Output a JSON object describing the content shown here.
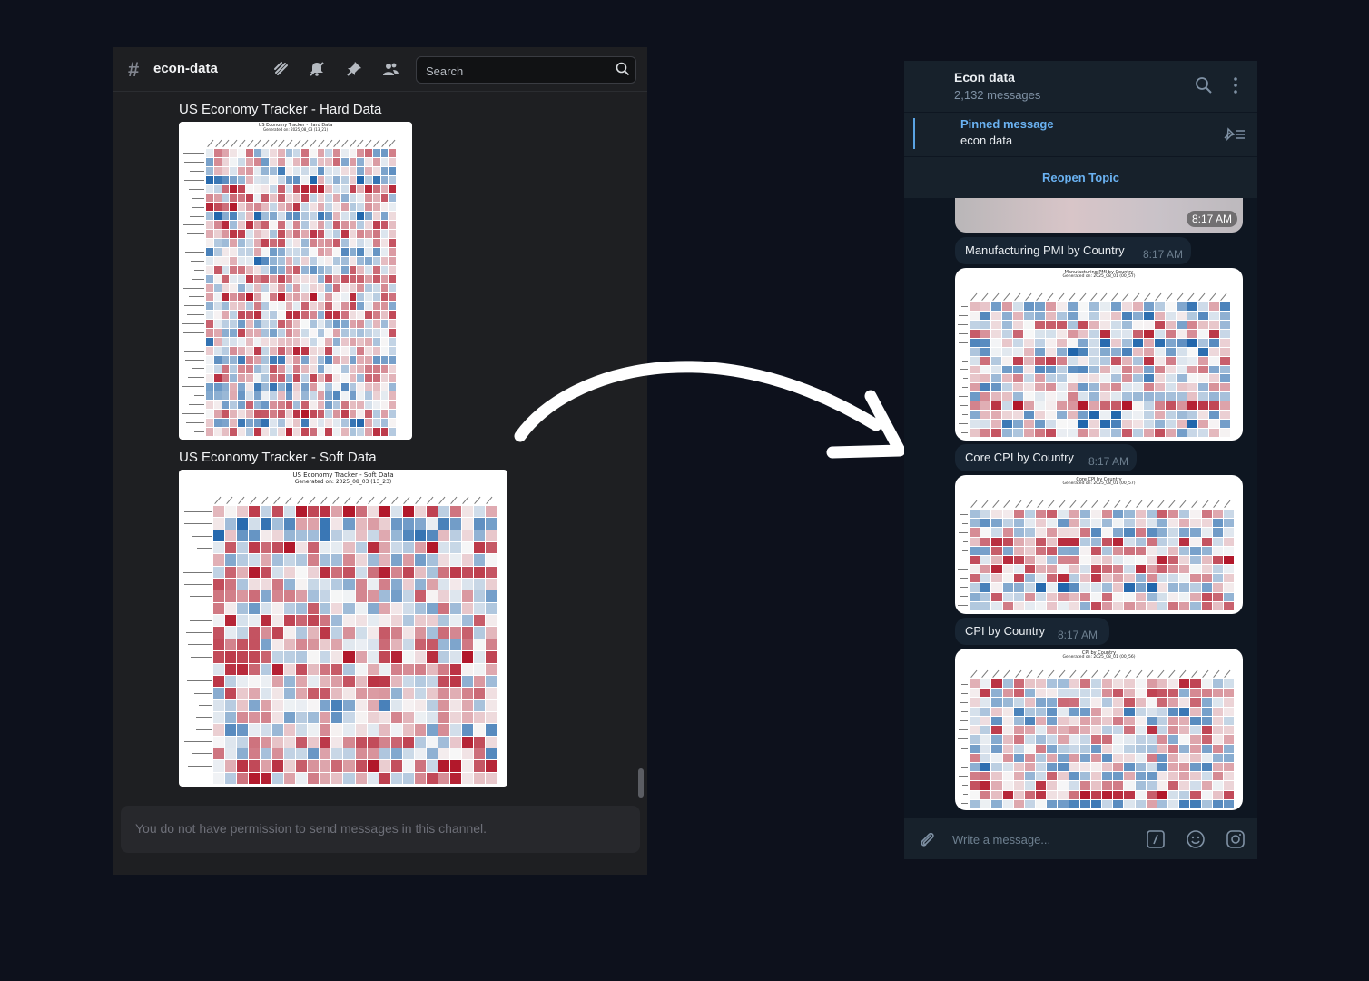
{
  "discord": {
    "channel": "econ-data",
    "search_placeholder": "Search",
    "messages": [
      {
        "title": "US Economy Tracker - Hard Data",
        "chart_title": "US Economy Tracker - Hard Data",
        "chart_sub": "Generated on: 2025_08_03 (13_21)"
      },
      {
        "title": "US Economy Tracker - Soft Data",
        "chart_title": "US Economy Tracker - Soft Data",
        "chart_sub": "Generated on: 2025_08_03 (13_23)"
      }
    ],
    "no_permission": "You do not have permission to send messages in this channel.",
    "icons": [
      "threads-icon",
      "mute-icon",
      "pin-icon",
      "members-icon",
      "search-icon"
    ]
  },
  "telegram": {
    "title": "Econ data",
    "subtitle": "2,132 messages",
    "pinned_title": "Pinned message",
    "pinned_text": "econ data",
    "reopen": "Reopen Topic",
    "top_time": "8:17 AM",
    "posts": [
      {
        "caption": "Manufacturing PMI by Country",
        "time": "8:17 AM",
        "chart_title": "Manufacturing PMI by Country",
        "chart_sub": "Generated on: 2025_08_01 (00_57)"
      },
      {
        "caption": "Core CPI by Country",
        "time": "8:17 AM",
        "chart_title": "Core CPI by Country",
        "chart_sub": "Generated on: 2025_08_01 (00_57)"
      },
      {
        "caption": "CPI by Country",
        "time": "8:17 AM",
        "chart_title": "CPI by Country",
        "chart_sub": "Generated on: 2025_08_01 (00_56)"
      }
    ],
    "compose_placeholder": "Write a message...",
    "icons": [
      "search-icon",
      "more-icon",
      "unpin-list-icon",
      "attach-icon",
      "commands-icon",
      "emoji-icon",
      "instagram-icon"
    ]
  },
  "colors": {
    "heat_red": "#b2182b",
    "heat_mid": "#f7f7f7",
    "heat_blue": "#2166ac",
    "link_blue": "#6ab2f2"
  }
}
